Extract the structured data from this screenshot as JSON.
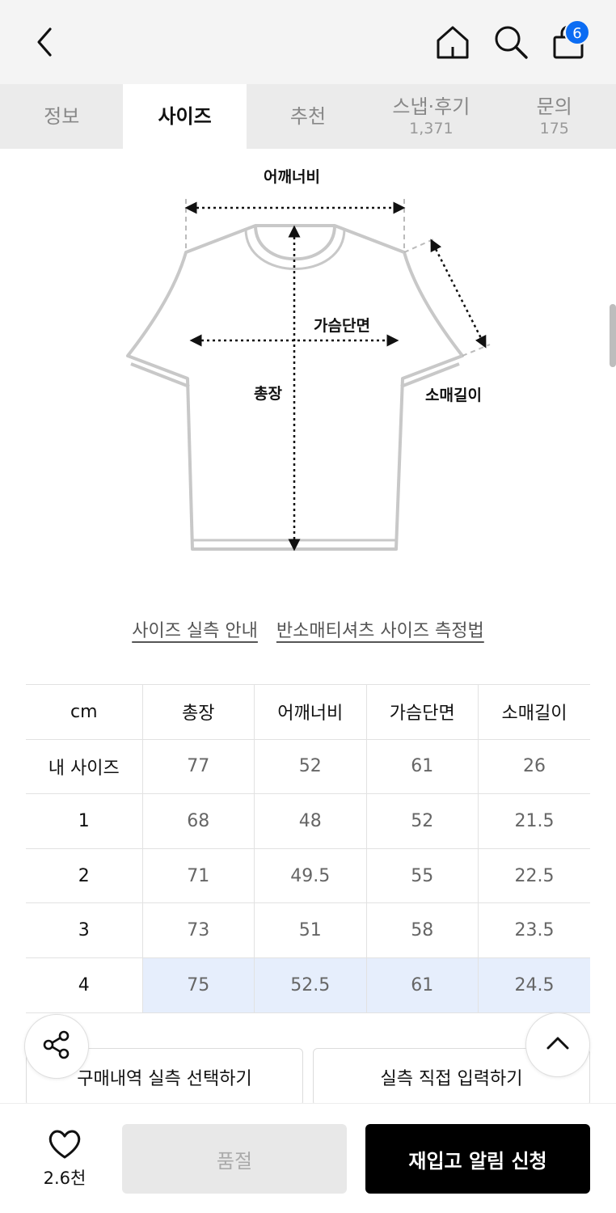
{
  "header": {
    "cart_count": "6",
    "icons": [
      "back-arrow-icon",
      "home-icon",
      "search-icon",
      "shopping-bag-icon"
    ]
  },
  "tabs": [
    {
      "label": "정보",
      "count": "",
      "active": false
    },
    {
      "label": "사이즈",
      "count": "",
      "active": true
    },
    {
      "label": "추천",
      "count": "",
      "active": false
    },
    {
      "label": "스냅·후기",
      "count": "1,371",
      "active": false
    },
    {
      "label": "문의",
      "count": "175",
      "active": false
    }
  ],
  "diagram": {
    "shoulder_label": "어깨너비",
    "chest_label": "가슴단면",
    "length_label": "총장",
    "sleeve_label": "소매길이"
  },
  "links": {
    "guide": "사이즈 실측 안내",
    "method": "반소매티셔츠 사이즈 측정법"
  },
  "size_table": {
    "headers": [
      "cm",
      "총장",
      "어깨너비",
      "가슴단면",
      "소매길이"
    ],
    "rows": [
      {
        "label": "내 사이즈",
        "values": [
          "77",
          "52",
          "61",
          "26"
        ]
      },
      {
        "label": "1",
        "values": [
          "68",
          "48",
          "52",
          "21.5"
        ]
      },
      {
        "label": "2",
        "values": [
          "71",
          "49.5",
          "55",
          "22.5"
        ]
      },
      {
        "label": "3",
        "values": [
          "73",
          "51",
          "58",
          "23.5"
        ]
      },
      {
        "label": "4",
        "values": [
          "75",
          "52.5",
          "61",
          "24.5"
        ],
        "highlighted": true
      }
    ]
  },
  "buttons": {
    "purchase_history": "구매내역 실측 선택하기",
    "manual_input": "실측 직접 입력하기",
    "sold_out": "품절",
    "restock_alert": "재입고 알림 신청"
  },
  "likes": {
    "count": "2.6천"
  },
  "colors": {
    "badge": "#0b6cf3",
    "highlight_row": "#e6eefc",
    "primary_button": "#000000"
  }
}
